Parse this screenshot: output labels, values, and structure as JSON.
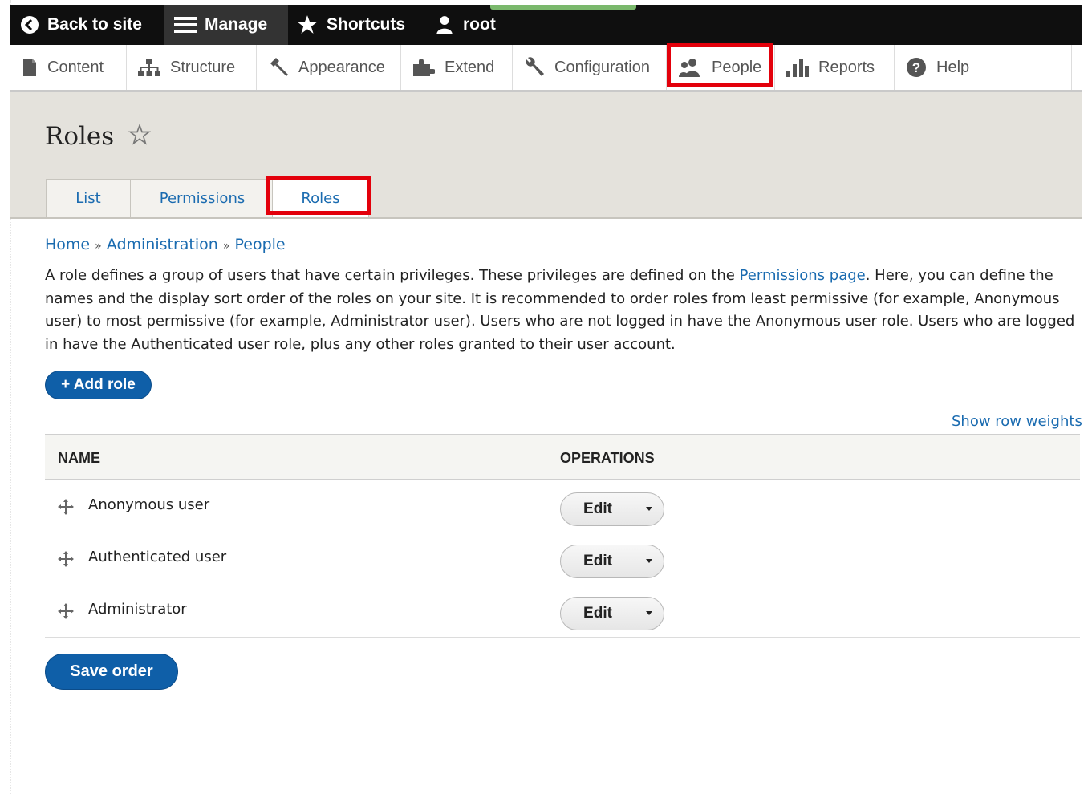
{
  "toolbar": {
    "back_to_site": "Back to site",
    "manage": "Manage",
    "shortcuts": "Shortcuts",
    "user": "root"
  },
  "menu": {
    "content": "Content",
    "structure": "Structure",
    "appearance": "Appearance",
    "extend": "Extend",
    "configuration": "Configuration",
    "people": "People",
    "reports": "Reports",
    "help": "Help"
  },
  "page": {
    "title": "Roles",
    "tabs": [
      "List",
      "Permissions",
      "Roles"
    ]
  },
  "breadcrumb": {
    "home": "Home",
    "sep": "»",
    "administration": "Administration",
    "people": "People"
  },
  "description": {
    "part1": "A role defines a group of users that have certain privileges. These privileges are defined on the ",
    "link": "Permissions page",
    "part2": ". Here, you can define the names and the display sort order of the roles on your site. It is recommended to order roles from least permissive (for example, Anonymous user) to most permissive (for example, Administrator user). Users who are not logged in have the Anonymous user role. Users who are logged in have the Authenticated user role, plus any other roles granted to their user account."
  },
  "actions": {
    "add_role": "+ Add role",
    "show_row_weights": "Show row weights",
    "save_order": "Save order"
  },
  "table": {
    "headers": {
      "name": "NAME",
      "operations": "OPERATIONS"
    },
    "rows": [
      {
        "name": "Anonymous user",
        "op": "Edit"
      },
      {
        "name": "Authenticated user",
        "op": "Edit"
      },
      {
        "name": "Administrator",
        "op": "Edit"
      }
    ]
  },
  "colors": {
    "link": "#1a6bb0",
    "primary_button": "#0f5fa8",
    "highlight": "#e3000b",
    "toolbar_bg": "#0f0f0f"
  }
}
